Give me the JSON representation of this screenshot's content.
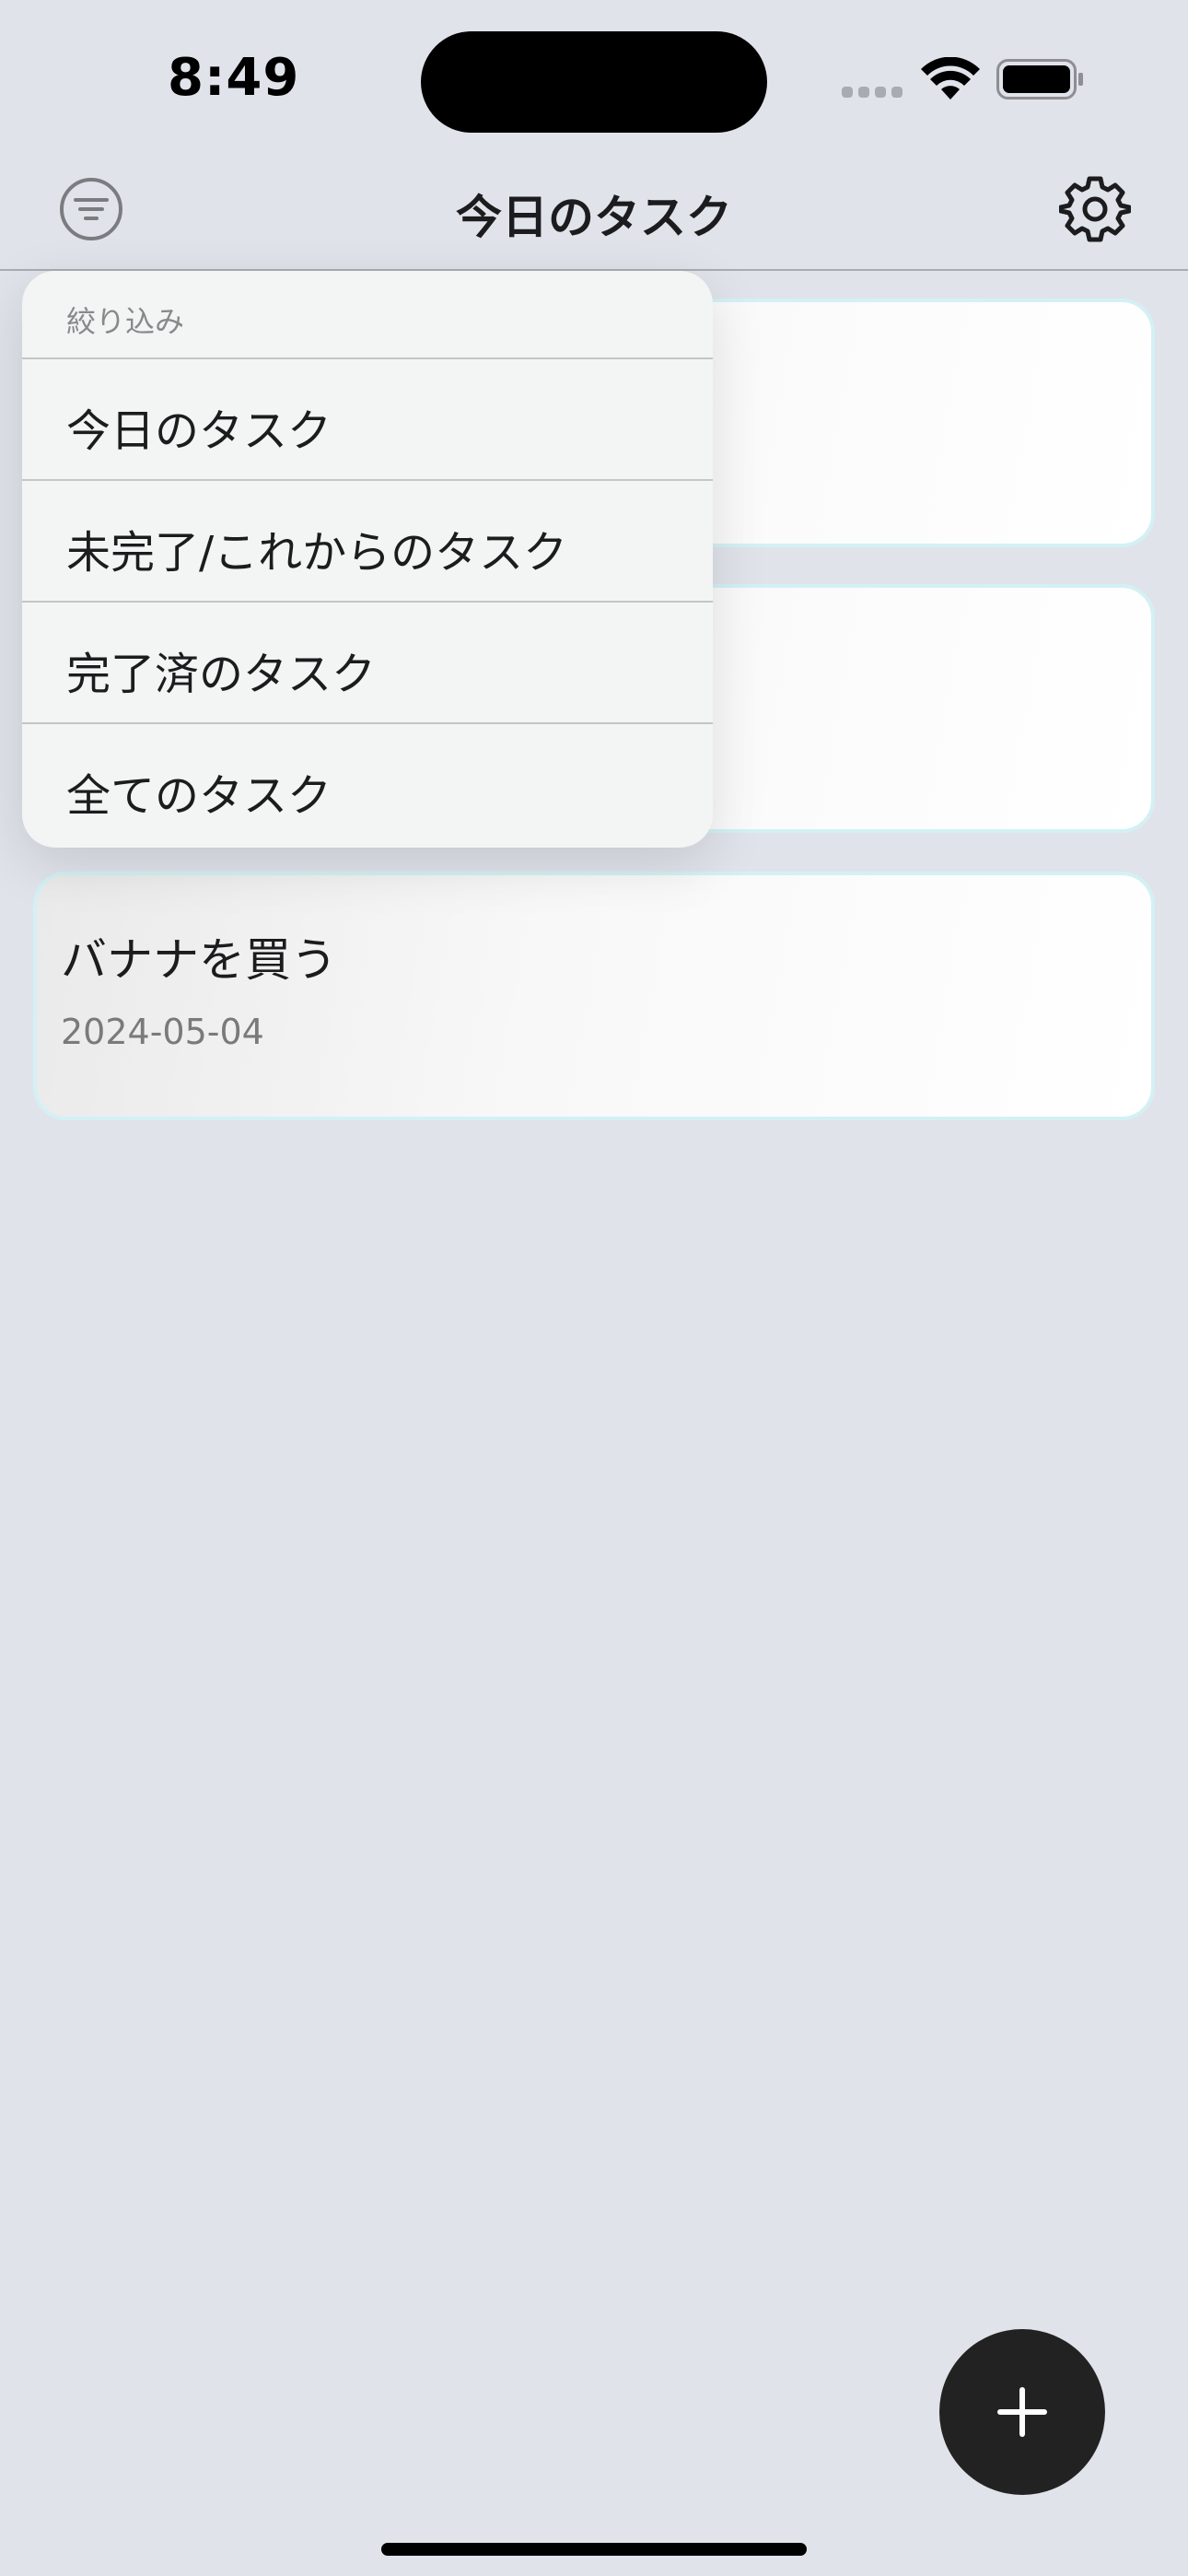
{
  "status_bar": {
    "time": "8:49"
  },
  "nav": {
    "title": "今日のタスク",
    "filter_icon": "filter-list-icon",
    "settings_icon": "gear-icon"
  },
  "tasks": [
    {
      "title": "",
      "date": ""
    },
    {
      "title": "",
      "date": ""
    },
    {
      "title": "バナナを買う",
      "date": "2024-05-04"
    }
  ],
  "filter_menu": {
    "header": "絞り込み",
    "items": [
      {
        "label": "今日のタスク"
      },
      {
        "label": "未完了/これからのタスク"
      },
      {
        "label": "完了済のタスク"
      },
      {
        "label": "全てのタスク"
      }
    ]
  },
  "fab": {
    "icon": "plus-icon"
  },
  "colors": {
    "background": "#e0e3ea",
    "card_border": "#d3f1f4",
    "fab": "#222222",
    "menu_background": "#f3f4f4"
  }
}
